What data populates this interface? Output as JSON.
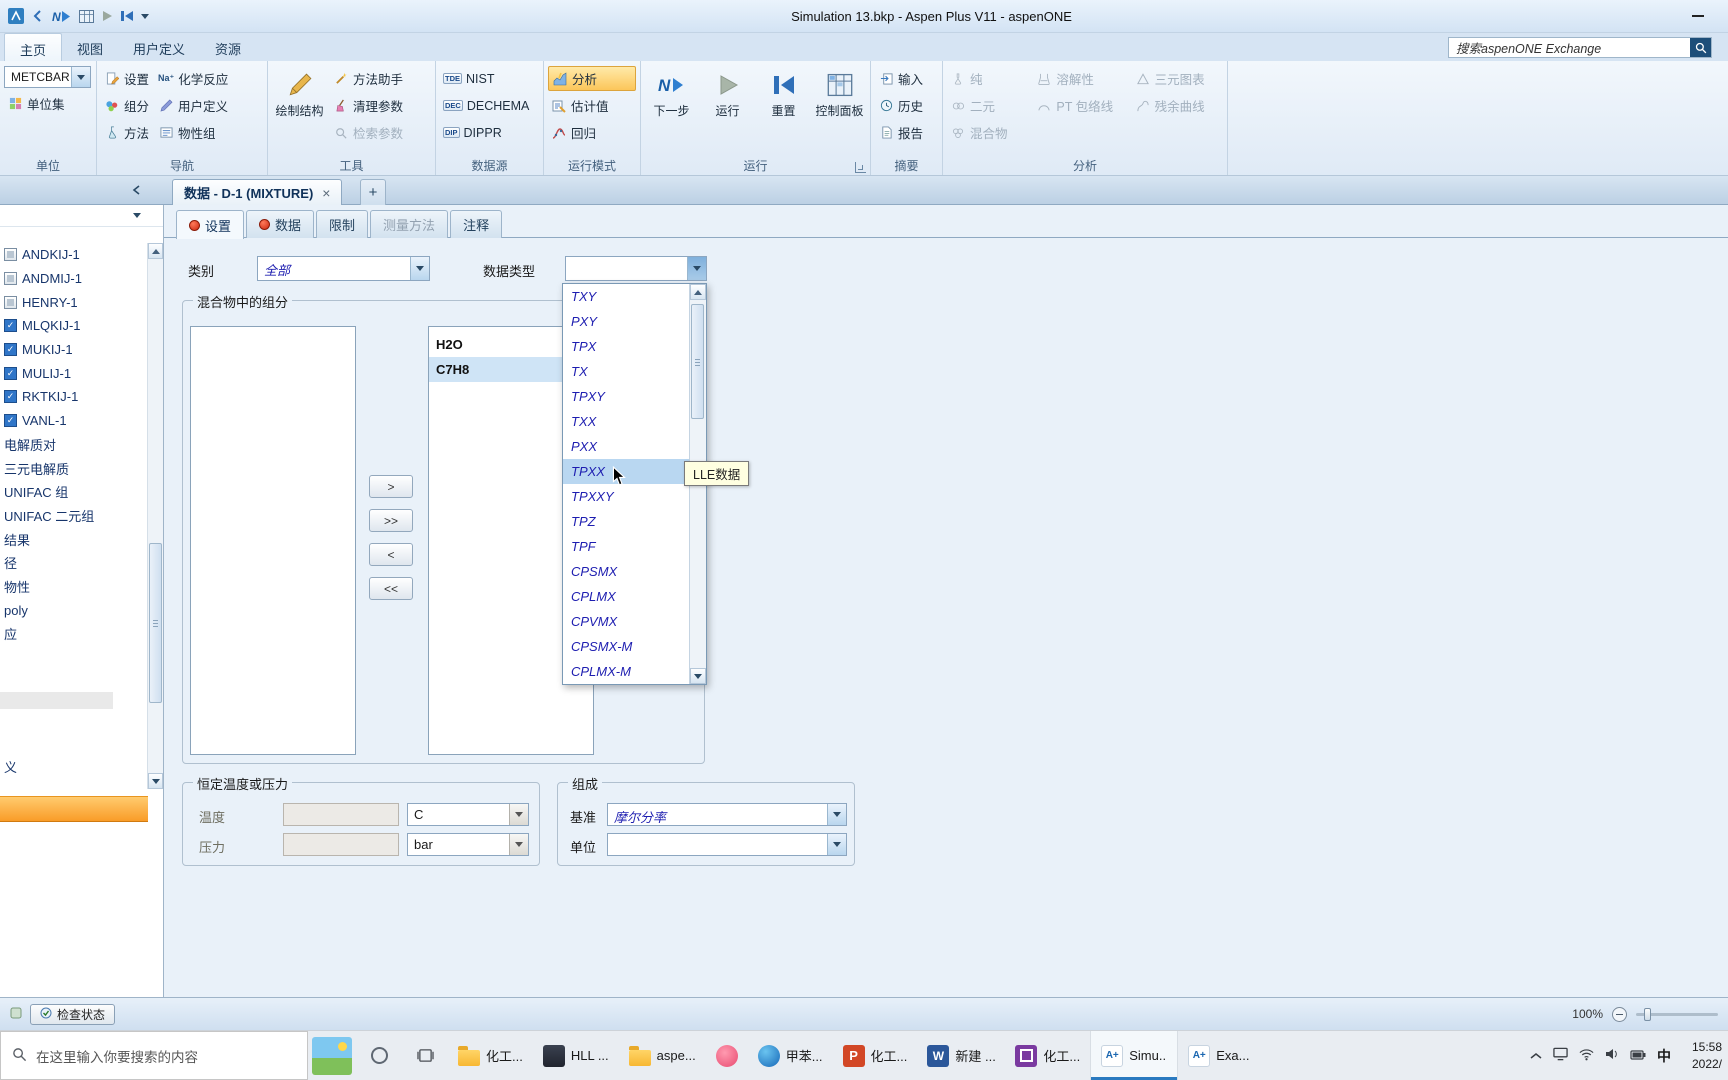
{
  "titlebar": {
    "title": "Simulation 13.bkp - Aspen Plus V11 - aspenONE"
  },
  "ribbon": {
    "tabs": [
      {
        "label": "主页",
        "active": true
      },
      {
        "label": "视图"
      },
      {
        "label": "用户定义"
      },
      {
        "label": "资源"
      }
    ],
    "search_placeholder": "搜索aspenONE Exchange",
    "units": {
      "label": "单位",
      "combo_value": "METCBAR",
      "unit_sets": "单位集"
    },
    "navigate": {
      "label": "导航",
      "setup": "设置",
      "components": "组分",
      "methods": "方法",
      "chemistry": "化学反应",
      "chemistry_glyph": "Na⁺",
      "customize": "用户定义",
      "prop_sets": "物性组"
    },
    "tools": {
      "label": "工具",
      "draw_structure": "绘制结构",
      "assistant": "方法助手",
      "clean": "清理参数",
      "retrieve": "检索参数"
    },
    "datasource": {
      "label": "数据源",
      "nist": "NIST",
      "nist_badge": "TDE",
      "dechema": "DECHEMA",
      "dechema_badge": "DEC",
      "dippr": "DIPPR",
      "dippr_badge": "DIP"
    },
    "runmode": {
      "label": "运行模式",
      "analysis": "分析",
      "estimation": "估计值",
      "regression": "回归"
    },
    "run": {
      "label": "运行",
      "next": "下一步",
      "run": "运行",
      "reset": "重置",
      "control_panel": "控制面板"
    },
    "summary": {
      "label": "摘要",
      "input": "输入",
      "history": "历史",
      "report": "报告"
    },
    "analysis": {
      "label": "分析",
      "pure": "纯",
      "binary": "二元",
      "mixture": "混合物",
      "solubility": "溶解性",
      "pt_envelope": "PT 包络线",
      "ternary": "三元图表",
      "residue": "残余曲线"
    }
  },
  "doctabs": {
    "active_label": "数据 - D-1 (MIXTURE)",
    "close_glyph": "×",
    "new_glyph": "+"
  },
  "sidebar": {
    "items": [
      {
        "label": "ANDKIJ-1",
        "icon": "ic-gray"
      },
      {
        "label": "ANDMIJ-1",
        "icon": "ic-gray"
      },
      {
        "label": "HENRY-1",
        "icon": "ic-gray"
      },
      {
        "label": "MLQKIJ-1",
        "icon": "ic-blue"
      },
      {
        "label": "MUKIJ-1",
        "icon": "ic-blue"
      },
      {
        "label": "MULIJ-1",
        "icon": "ic-blue"
      },
      {
        "label": "RKTKIJ-1",
        "icon": "ic-blue"
      },
      {
        "label": "VANL-1",
        "icon": "ic-blue"
      },
      {
        "label": "电解质对",
        "icon": "ic-none"
      },
      {
        "label": "三元电解质",
        "icon": "ic-none"
      },
      {
        "label": "UNIFAC 组",
        "icon": "ic-none"
      },
      {
        "label": "UNIFAC 二元组",
        "icon": "ic-none"
      },
      {
        "label": "结果",
        "icon": "ic-none"
      },
      {
        "label": "径",
        "icon": "ic-none"
      },
      {
        "label": "物性",
        "icon": "ic-none"
      },
      {
        "label": "poly",
        "icon": "ic-none"
      },
      {
        "label": "应",
        "icon": "ic-none"
      }
    ],
    "bottom_item": "义"
  },
  "form": {
    "tabs": [
      {
        "label": "设置",
        "active": true,
        "status": "red"
      },
      {
        "label": "数据",
        "status": "red"
      },
      {
        "label": "限制"
      },
      {
        "label": "测量方法",
        "disabled": true
      },
      {
        "label": "注释"
      }
    ],
    "category_label": "类别",
    "category_value": "全部",
    "datatype_label": "数据类型",
    "datatype_value": "",
    "datatype_dropdown": {
      "items": [
        {
          "label": "TXY"
        },
        {
          "label": "PXY"
        },
        {
          "label": "TPX"
        },
        {
          "label": "TX"
        },
        {
          "label": "TPXY"
        },
        {
          "label": "TXX"
        },
        {
          "label": "PXX"
        },
        {
          "label": "TPXX",
          "selected": true
        },
        {
          "label": "TPXXY"
        },
        {
          "label": "TPZ"
        },
        {
          "label": "TPF"
        },
        {
          "label": "CPSMX"
        },
        {
          "label": "CPLMX"
        },
        {
          "label": "CPVMX"
        },
        {
          "label": "CPSMX-M"
        },
        {
          "label": "CPLMX-M"
        }
      ],
      "tooltip": "LLE数据"
    },
    "components": {
      "legend": "混合物中的组分",
      "selected_items": [
        {
          "label": "H2O"
        },
        {
          "label": "C7H8",
          "selected": true
        }
      ],
      "transfer_buttons": [
        ">",
        ">>",
        "<",
        "<<"
      ]
    },
    "temp_pressure": {
      "legend": "恒定温度或压力",
      "temperature_label": "温度",
      "temperature_unit": "C",
      "pressure_label": "压力",
      "pressure_unit": "bar"
    },
    "composition": {
      "legend": "组成",
      "basis_label": "基准",
      "basis_value": "摩尔分率",
      "units_label": "单位",
      "units_value": ""
    }
  },
  "statusbar": {
    "check_status": "检查状态",
    "zoom": "100%"
  },
  "taskbar": {
    "search_placeholder": "在这里输入你要搜索的内容",
    "apps": [
      {
        "label": "化工...",
        "icon": "tb-folder"
      },
      {
        "label": "HLL ...",
        "icon": "tb-dark"
      },
      {
        "label": "aspe...",
        "icon": "tb-folder"
      },
      {
        "label": "",
        "icon": "tb-pink"
      },
      {
        "label": "甲苯...",
        "icon": "tb-browser"
      },
      {
        "label": "化工...",
        "icon": "tb-ppt"
      },
      {
        "label": "新建 ...",
        "icon": "tb-word"
      },
      {
        "label": "化工...",
        "icon": "tb-purple"
      },
      {
        "label": "Simu...",
        "icon": "tb-aspen",
        "active": true
      },
      {
        "label": "Exa...",
        "icon": "tb-aspen"
      }
    ],
    "ime": "中",
    "time": "15:58",
    "date": "2022/"
  }
}
